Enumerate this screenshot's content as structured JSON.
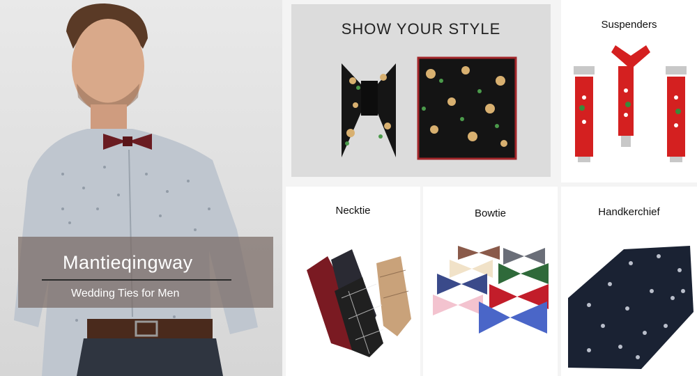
{
  "hero": {
    "brand": "Mantieqingway",
    "tagline": "Wedding Ties for Men"
  },
  "showcase": {
    "title": "SHOW YOUR STYLE"
  },
  "products": {
    "suspenders": "Suspenders",
    "necktie": "Necktie",
    "bowtie": "Bowtie",
    "handkerchief": "Handkerchief"
  },
  "colors": {
    "banner_overlay": "#78695f",
    "accent_red": "#d42020",
    "floral_gold": "#d8b070"
  }
}
